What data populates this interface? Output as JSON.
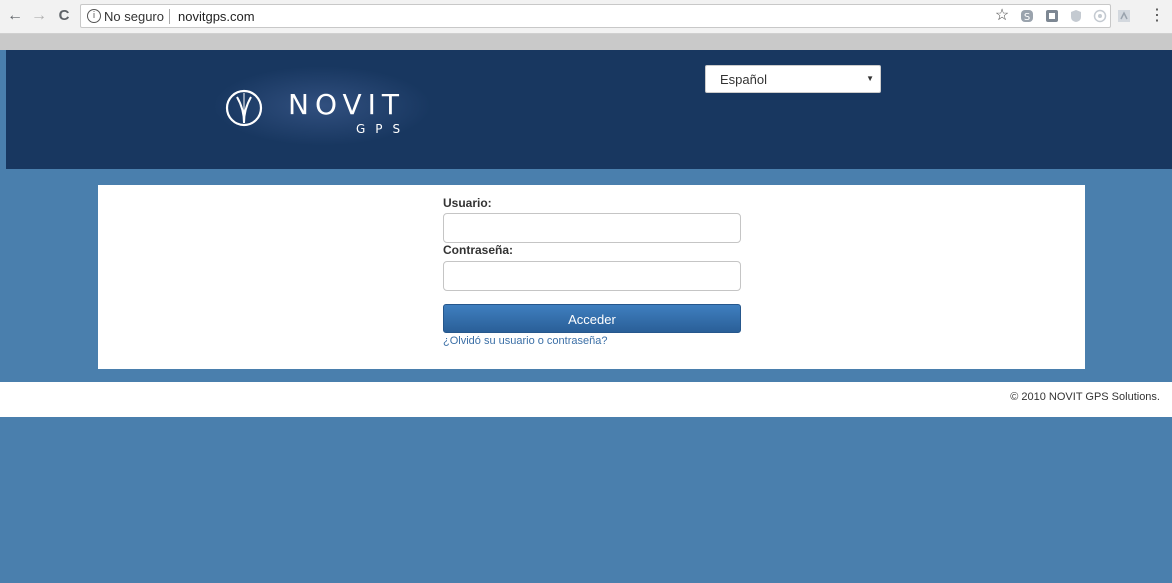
{
  "browser": {
    "back_glyph": "←",
    "forward_glyph": "→",
    "reload_glyph": "C",
    "info_glyph": "i",
    "security_text": "No seguro",
    "url": "novitgps.com",
    "star_glyph": "☆",
    "menu_glyph": "⋮"
  },
  "header": {
    "logo_text": "NOVIT",
    "logo_subtext": "GPS",
    "language": {
      "selected": "Español",
      "caret": "▼"
    }
  },
  "login": {
    "username_label": "Usuario:",
    "username_value": "",
    "password_label": "Contraseña:",
    "password_value": "",
    "submit_label": "Acceder",
    "forgot_link": "¿Olvidó su usuario o contraseña?"
  },
  "footer": {
    "copyright": "© 2010 NOVIT GPS Solutions."
  },
  "colors": {
    "page_background": "#4a7fad",
    "header_background": "#183760",
    "button": "#2f6aa8"
  }
}
